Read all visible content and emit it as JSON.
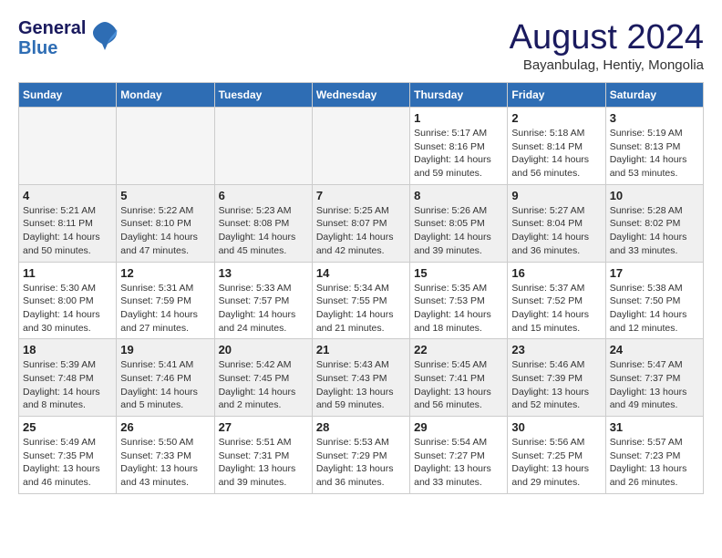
{
  "header": {
    "logo_line1": "General",
    "logo_line2": "Blue",
    "title": "August 2024",
    "subtitle": "Bayanbulag, Hentiy, Mongolia"
  },
  "weekdays": [
    "Sunday",
    "Monday",
    "Tuesday",
    "Wednesday",
    "Thursday",
    "Friday",
    "Saturday"
  ],
  "weeks": [
    [
      {
        "day": "",
        "info": ""
      },
      {
        "day": "",
        "info": ""
      },
      {
        "day": "",
        "info": ""
      },
      {
        "day": "",
        "info": ""
      },
      {
        "day": "1",
        "info": "Sunrise: 5:17 AM\nSunset: 8:16 PM\nDaylight: 14 hours\nand 59 minutes."
      },
      {
        "day": "2",
        "info": "Sunrise: 5:18 AM\nSunset: 8:14 PM\nDaylight: 14 hours\nand 56 minutes."
      },
      {
        "day": "3",
        "info": "Sunrise: 5:19 AM\nSunset: 8:13 PM\nDaylight: 14 hours\nand 53 minutes."
      }
    ],
    [
      {
        "day": "4",
        "info": "Sunrise: 5:21 AM\nSunset: 8:11 PM\nDaylight: 14 hours\nand 50 minutes."
      },
      {
        "day": "5",
        "info": "Sunrise: 5:22 AM\nSunset: 8:10 PM\nDaylight: 14 hours\nand 47 minutes."
      },
      {
        "day": "6",
        "info": "Sunrise: 5:23 AM\nSunset: 8:08 PM\nDaylight: 14 hours\nand 45 minutes."
      },
      {
        "day": "7",
        "info": "Sunrise: 5:25 AM\nSunset: 8:07 PM\nDaylight: 14 hours\nand 42 minutes."
      },
      {
        "day": "8",
        "info": "Sunrise: 5:26 AM\nSunset: 8:05 PM\nDaylight: 14 hours\nand 39 minutes."
      },
      {
        "day": "9",
        "info": "Sunrise: 5:27 AM\nSunset: 8:04 PM\nDaylight: 14 hours\nand 36 minutes."
      },
      {
        "day": "10",
        "info": "Sunrise: 5:28 AM\nSunset: 8:02 PM\nDaylight: 14 hours\nand 33 minutes."
      }
    ],
    [
      {
        "day": "11",
        "info": "Sunrise: 5:30 AM\nSunset: 8:00 PM\nDaylight: 14 hours\nand 30 minutes."
      },
      {
        "day": "12",
        "info": "Sunrise: 5:31 AM\nSunset: 7:59 PM\nDaylight: 14 hours\nand 27 minutes."
      },
      {
        "day": "13",
        "info": "Sunrise: 5:33 AM\nSunset: 7:57 PM\nDaylight: 14 hours\nand 24 minutes."
      },
      {
        "day": "14",
        "info": "Sunrise: 5:34 AM\nSunset: 7:55 PM\nDaylight: 14 hours\nand 21 minutes."
      },
      {
        "day": "15",
        "info": "Sunrise: 5:35 AM\nSunset: 7:53 PM\nDaylight: 14 hours\nand 18 minutes."
      },
      {
        "day": "16",
        "info": "Sunrise: 5:37 AM\nSunset: 7:52 PM\nDaylight: 14 hours\nand 15 minutes."
      },
      {
        "day": "17",
        "info": "Sunrise: 5:38 AM\nSunset: 7:50 PM\nDaylight: 14 hours\nand 12 minutes."
      }
    ],
    [
      {
        "day": "18",
        "info": "Sunrise: 5:39 AM\nSunset: 7:48 PM\nDaylight: 14 hours\nand 8 minutes."
      },
      {
        "day": "19",
        "info": "Sunrise: 5:41 AM\nSunset: 7:46 PM\nDaylight: 14 hours\nand 5 minutes."
      },
      {
        "day": "20",
        "info": "Sunrise: 5:42 AM\nSunset: 7:45 PM\nDaylight: 14 hours\nand 2 minutes."
      },
      {
        "day": "21",
        "info": "Sunrise: 5:43 AM\nSunset: 7:43 PM\nDaylight: 13 hours\nand 59 minutes."
      },
      {
        "day": "22",
        "info": "Sunrise: 5:45 AM\nSunset: 7:41 PM\nDaylight: 13 hours\nand 56 minutes."
      },
      {
        "day": "23",
        "info": "Sunrise: 5:46 AM\nSunset: 7:39 PM\nDaylight: 13 hours\nand 52 minutes."
      },
      {
        "day": "24",
        "info": "Sunrise: 5:47 AM\nSunset: 7:37 PM\nDaylight: 13 hours\nand 49 minutes."
      }
    ],
    [
      {
        "day": "25",
        "info": "Sunrise: 5:49 AM\nSunset: 7:35 PM\nDaylight: 13 hours\nand 46 minutes."
      },
      {
        "day": "26",
        "info": "Sunrise: 5:50 AM\nSunset: 7:33 PM\nDaylight: 13 hours\nand 43 minutes."
      },
      {
        "day": "27",
        "info": "Sunrise: 5:51 AM\nSunset: 7:31 PM\nDaylight: 13 hours\nand 39 minutes."
      },
      {
        "day": "28",
        "info": "Sunrise: 5:53 AM\nSunset: 7:29 PM\nDaylight: 13 hours\nand 36 minutes."
      },
      {
        "day": "29",
        "info": "Sunrise: 5:54 AM\nSunset: 7:27 PM\nDaylight: 13 hours\nand 33 minutes."
      },
      {
        "day": "30",
        "info": "Sunrise: 5:56 AM\nSunset: 7:25 PM\nDaylight: 13 hours\nand 29 minutes."
      },
      {
        "day": "31",
        "info": "Sunrise: 5:57 AM\nSunset: 7:23 PM\nDaylight: 13 hours\nand 26 minutes."
      }
    ]
  ]
}
